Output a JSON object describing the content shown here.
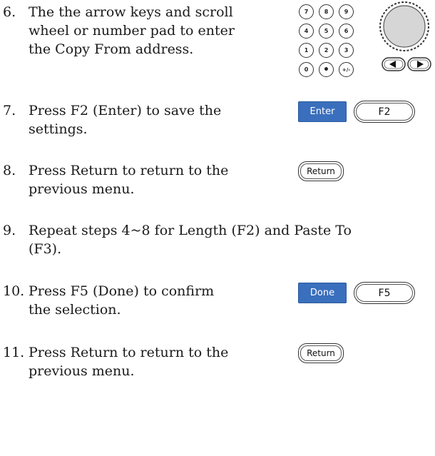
{
  "steps": [
    {
      "number": "6.",
      "lines": [
        "The the arrow keys and scroll",
        "wheel or number pad to enter",
        "the Copy From address."
      ]
    },
    {
      "number": "7.",
      "lines": [
        "Press F2 (Enter) to save the",
        "settings."
      ]
    },
    {
      "number": "8.",
      "lines": [
        "Press Return to return to the",
        "previous menu."
      ]
    },
    {
      "number": "9.",
      "lines": [
        "Repeat steps 4~8 for Length (F2) and Paste To",
        "(F3)."
      ]
    },
    {
      "number": "10.",
      "lines": [
        "Press F5 (Done) to confirm",
        "the selection."
      ]
    },
    {
      "number": "11.",
      "lines": [
        "Press Return to return to the",
        "previous menu."
      ]
    }
  ],
  "keypad": {
    "keys": [
      "7",
      "8",
      "9",
      "4",
      "5",
      "6",
      "1",
      "2",
      "3",
      "0",
      "•",
      "+/-"
    ]
  },
  "buttons": {
    "enter_softkey": "Enter",
    "f2_key": "F2",
    "return_key_1": "Return",
    "done_softkey": "Done",
    "f5_key": "F5",
    "return_key_2": "Return"
  },
  "icons": {
    "scroll_wheel": "scroll-wheel-icon",
    "arrow_left": "left-arrow-key-icon",
    "arrow_right": "right-arrow-key-icon"
  },
  "colors": {
    "softkey_blue": "#3a6fbd"
  }
}
